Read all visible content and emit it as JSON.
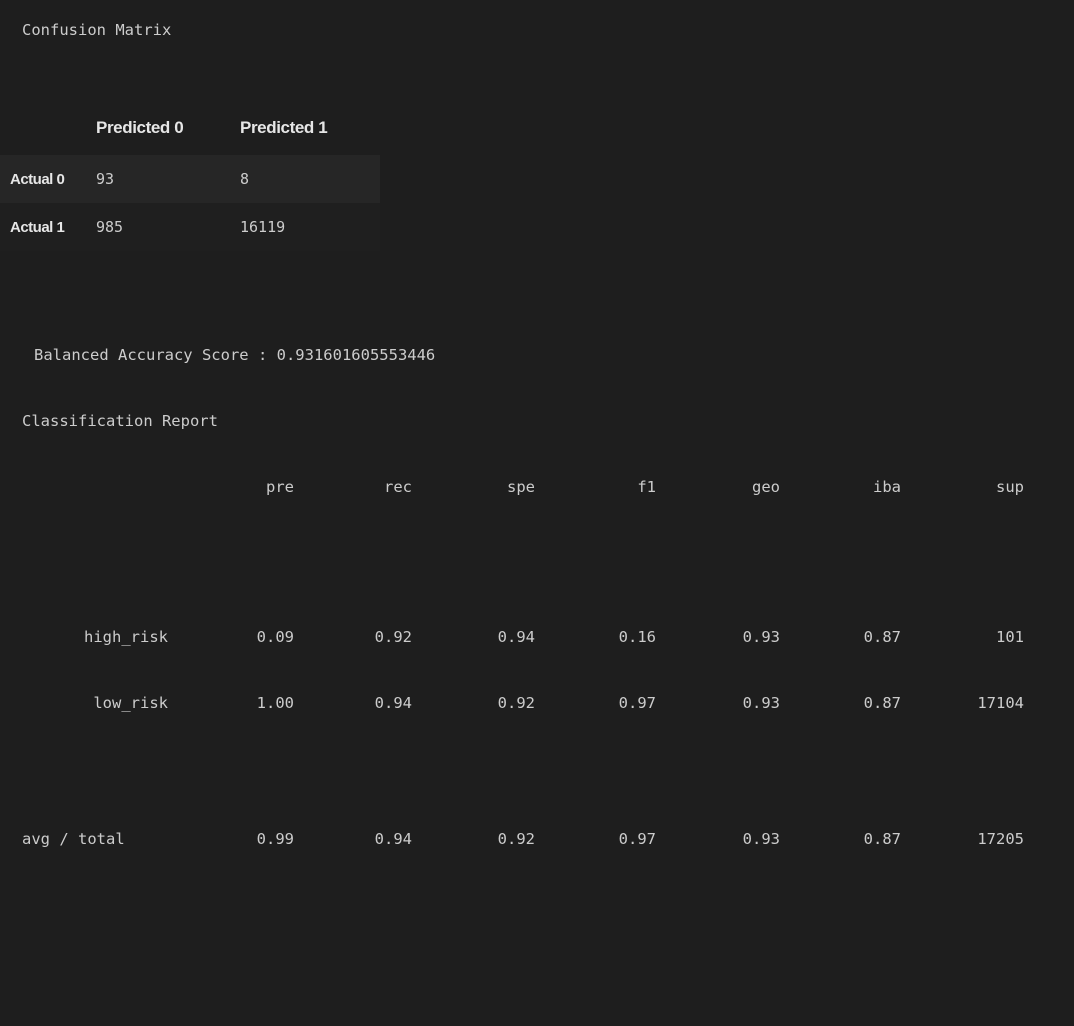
{
  "title": "Confusion Matrix",
  "confusion_matrix": {
    "columns": [
      "Predicted 0",
      "Predicted 1"
    ],
    "rows": [
      {
        "label": "Actual 0",
        "values": [
          "93",
          "8"
        ]
      },
      {
        "label": "Actual 1",
        "values": [
          "985",
          "16119"
        ]
      }
    ]
  },
  "balanced_accuracy": "Balanced Accuracy Score : 0.931601605553446",
  "report_title": "Classification Report",
  "report": {
    "headers": [
      "pre",
      "rec",
      "spe",
      "f1",
      "geo",
      "iba",
      "sup"
    ],
    "rows": [
      {
        "label": "high_risk",
        "values": [
          "0.09",
          "0.92",
          "0.94",
          "0.16",
          "0.93",
          "0.87",
          "101"
        ]
      },
      {
        "label": "low_risk",
        "values": [
          "1.00",
          "0.94",
          "0.92",
          "0.97",
          "0.93",
          "0.87",
          "17104"
        ]
      }
    ],
    "total": {
      "label": "avg / total",
      "values": [
        "0.99",
        "0.94",
        "0.92",
        "0.97",
        "0.93",
        "0.87",
        "17205"
      ]
    }
  }
}
